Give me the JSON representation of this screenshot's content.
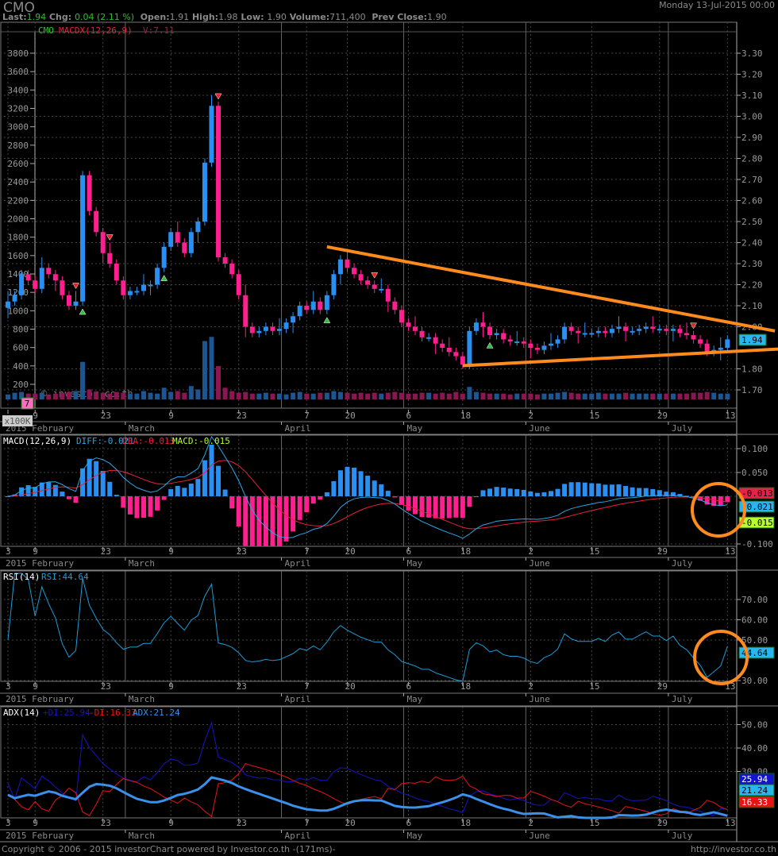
{
  "header": {
    "symbol": "CMO",
    "date": "Monday 13-Jul-2015 00:00",
    "last_label": "Last:",
    "last": "1.94",
    "chg_label": "Chg:",
    "chg": "0.04 (2.11 %)",
    "open_label": "Open:",
    "open": "1.91",
    "high_label": "High:",
    "high": "1.98",
    "low_label": "Low:",
    "low": "1.90",
    "volume_label": "Volume:",
    "volume": "711,400",
    "prev_label": "Prev Close:",
    "prev": "1.90"
  },
  "main": {
    "legend_symbol": "CMO",
    "legend_indicator": "MACDX(12,26,9)",
    "legend_v": "V:7.11",
    "watermark": "© investor.co.th",
    "volume_unit": "x100K",
    "volume_badge": "7",
    "last_badge": "1.94",
    "left_axis": [
      "3800",
      "3600",
      "3400",
      "3200",
      "3000",
      "2800",
      "2600",
      "2400",
      "2200",
      "2000",
      "1800",
      "1600",
      "1400",
      "1200",
      "1000",
      "800",
      "600",
      "400",
      "200"
    ],
    "right_axis": [
      "3.30",
      "3.20",
      "3.10",
      "3.00",
      "2.90",
      "2.80",
      "2.70",
      "2.60",
      "2.50",
      "2.40",
      "2.30",
      "2.20",
      "2.10",
      "2.00",
      "1.80",
      "1.70"
    ]
  },
  "macd": {
    "title": "MACD(12,26,9)",
    "diff": "DIFF:-0.021",
    "dea": "DEA:-0.013",
    "macd": "MACD:-0.015",
    "axis": [
      "0.100",
      "0.050",
      "-0.100"
    ],
    "badge_dea": "-0.013",
    "badge_diff": "-0.021",
    "badge_macd": "-0.015"
  },
  "rsi": {
    "title": "RSI(14)",
    "value": "RSI:44.64",
    "axis": [
      "70.00",
      "60.00",
      "50.00",
      "30.00"
    ],
    "badge": "44.64"
  },
  "adx": {
    "title": "ADX(14)",
    "pdi": "+DI:25.94",
    "mdi": "-DI:16.33",
    "adx": "ADX:21.24",
    "axis": [
      "50.00",
      "40.00",
      "30.00"
    ],
    "badge_pdi": "25.94",
    "badge_adx": "21.24",
    "badge_mdi": "16.33"
  },
  "footer": {
    "copyright": "Copyright © 2006 - 2015 investorChart powered by Investor.co.th -(171ms)-",
    "url": "http://investor.co.th"
  },
  "colors": {
    "up": "#2a8ff0",
    "down": "#ff1f8e",
    "vol_up": "#1d5590",
    "vol_down": "#8c1552",
    "diff": "#2aa8e6",
    "dea": "#e8203c",
    "rsi": "#1e9bd7",
    "pdi": "#1414c8",
    "mdi": "#e81414",
    "adx_line": "#3a90ea",
    "trend": "#ff8a1e"
  },
  "chart_data": {
    "type": "candlestick",
    "closes": [
      2.12,
      2.15,
      2.25,
      2.22,
      2.18,
      2.28,
      2.25,
      2.22,
      2.15,
      2.1,
      2.12,
      2.72,
      2.55,
      2.45,
      2.35,
      2.3,
      2.22,
      2.15,
      2.17,
      2.17,
      2.2,
      2.2,
      2.28,
      2.38,
      2.45,
      2.4,
      2.35,
      2.45,
      2.5,
      2.78,
      3.05,
      2.33,
      2.3,
      2.25,
      2.15,
      2.0,
      1.97,
      1.98,
      2.0,
      1.98,
      1.99,
      2.02,
      2.05,
      2.1,
      2.08,
      2.12,
      2.08,
      2.15,
      2.25,
      2.32,
      2.28,
      2.25,
      2.22,
      2.2,
      2.18,
      2.18,
      2.12,
      2.08,
      2.02,
      2.0,
      1.98,
      1.95,
      1.95,
      1.92,
      1.9,
      1.88,
      1.86,
      1.82,
      1.98,
      2.02,
      2.0,
      1.96,
      1.97,
      1.94,
      1.93,
      1.93,
      1.92,
      1.9,
      1.89,
      1.91,
      1.92,
      1.94,
      2.0,
      1.98,
      1.97,
      1.97,
      1.97,
      1.98,
      1.97,
      1.99,
      2.0,
      1.98,
      1.98,
      1.99,
      2.0,
      1.99,
      1.99,
      1.98,
      1.99,
      1.97,
      1.96,
      1.94,
      1.92,
      1.88,
      1.89,
      1.9,
      1.94
    ],
    "volumes": [
      6,
      8,
      9,
      7,
      7,
      8,
      6,
      7,
      8,
      9,
      10,
      45,
      12,
      9,
      8,
      7,
      9,
      8,
      7,
      7,
      10,
      8,
      7,
      14,
      9,
      10,
      8,
      16,
      12,
      70,
      75,
      40,
      14,
      10,
      8,
      9,
      7,
      7,
      8,
      7,
      7,
      6,
      8,
      9,
      7,
      7,
      8,
      8,
      10,
      9,
      8,
      7,
      8,
      7,
      8,
      7,
      8,
      9,
      8,
      7,
      7,
      8,
      8,
      7,
      8,
      7,
      9,
      7,
      15,
      9,
      8,
      7,
      7,
      7,
      6,
      7,
      7,
      7,
      6,
      7,
      7,
      8,
      9,
      8,
      7,
      7,
      7,
      8,
      7,
      7,
      7,
      8,
      7,
      7,
      7,
      7,
      7,
      7,
      7,
      7,
      7,
      8,
      8,
      9,
      8,
      7,
      7
    ],
    "date_ticks": [
      {
        "label": "3",
        "index": 0
      },
      {
        "label": "9",
        "index": 4
      },
      {
        "label": "23",
        "index": 14
      },
      {
        "label": "9",
        "index": 24
      },
      {
        "label": "23",
        "index": 34
      },
      {
        "label": "7",
        "index": 44
      },
      {
        "label": "20",
        "index": 50
      },
      {
        "label": "6",
        "index": 59
      },
      {
        "label": "18",
        "index": 67
      },
      {
        "label": "2",
        "index": 77
      },
      {
        "label": "15",
        "index": 86
      },
      {
        "label": "29",
        "index": 96
      },
      {
        "label": "13",
        "index": 106
      }
    ],
    "months": [
      {
        "label": "2015 February",
        "index": -1
      },
      {
        "label": "March",
        "index": 18
      },
      {
        "label": "April",
        "index": 41
      },
      {
        "label": "May",
        "index": 59
      },
      {
        "label": "June",
        "index": 77
      },
      {
        "label": "July",
        "index": 98
      }
    ],
    "trendlines": [
      [
        {
          "index": 47,
          "price": 2.38
        },
        {
          "index": 113,
          "price": 1.98
        }
      ],
      [
        {
          "index": 67,
          "price": 1.815
        },
        {
          "index": 114,
          "price": 1.895
        }
      ]
    ],
    "signals": [
      {
        "index": 10,
        "type": "sell"
      },
      {
        "index": 11,
        "type": "buy"
      },
      {
        "index": 15,
        "type": "sell"
      },
      {
        "index": 23,
        "type": "buy"
      },
      {
        "index": 31,
        "type": "sell"
      },
      {
        "index": 47,
        "type": "buy"
      },
      {
        "index": 54,
        "type": "sell"
      },
      {
        "index": 71,
        "type": "buy"
      },
      {
        "index": 101,
        "type": "sell"
      }
    ]
  }
}
